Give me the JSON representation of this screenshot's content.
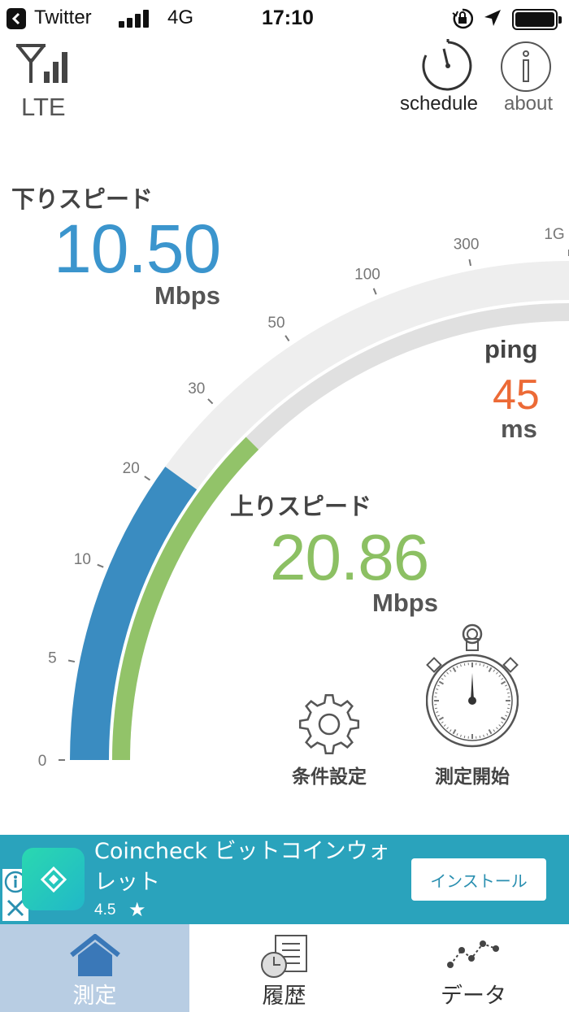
{
  "status_bar": {
    "back_app": "Twitter",
    "network": "4G",
    "time": "17:10"
  },
  "header": {
    "network_type": "LTE",
    "schedule_label": "schedule",
    "about_label": "about"
  },
  "gauge": {
    "scale_labels": [
      "0",
      "5",
      "10",
      "20",
      "30",
      "50",
      "100",
      "300",
      "1G"
    ],
    "download_fraction": 0.4,
    "upload_fraction": 0.5,
    "colors": {
      "track": "#eeeeee",
      "track_inner": "#e0e0e0",
      "download": "#3a8cc1",
      "upload": "#92c369"
    }
  },
  "download": {
    "title": "下りスピード",
    "value": "10.50",
    "unit": "Mbps",
    "color": "#3b95cd"
  },
  "ping": {
    "title": "ping",
    "value": "45",
    "unit": "ms",
    "color": "#ec6a36"
  },
  "upload": {
    "title": "上りスピード",
    "value": "20.86",
    "unit": "Mbps",
    "color": "#8cc063"
  },
  "actions": {
    "settings_label": "条件設定",
    "start_label": "測定開始"
  },
  "ad": {
    "title": "Coincheck ビットコインウォレット",
    "rating": "4.5",
    "install_label": "インストール",
    "background": "#2aa3bc"
  },
  "tabs": [
    {
      "label": "測定",
      "icon": "home-icon",
      "active": true
    },
    {
      "label": "履歴",
      "icon": "history-icon",
      "active": false
    },
    {
      "label": "データ",
      "icon": "graph-icon",
      "active": false
    }
  ]
}
